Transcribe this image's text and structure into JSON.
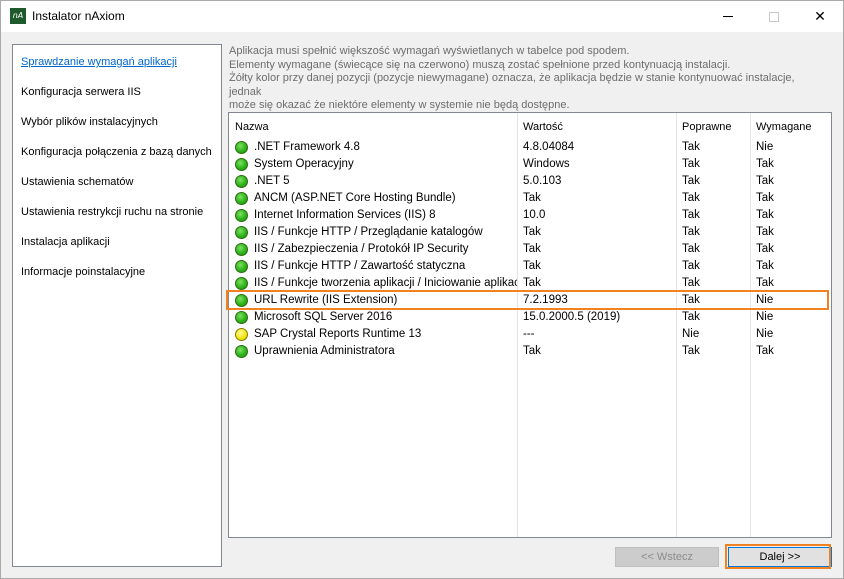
{
  "window": {
    "title": "Instalator nAxiom",
    "icon_label": "nA",
    "icon_color": "#1f5a2c"
  },
  "sidebar": {
    "items": [
      {
        "label": "Sprawdzanie wymagań aplikacji",
        "active": true
      },
      {
        "label": "Konfiguracja serwera IIS",
        "active": false
      },
      {
        "label": "Wybór plików instalacyjnych",
        "active": false
      },
      {
        "label": "Konfiguracja połączenia z bazą danych",
        "active": false
      },
      {
        "label": "Ustawienia schematów",
        "active": false
      },
      {
        "label": "Ustawienia restrykcji ruchu na stronie",
        "active": false
      },
      {
        "label": "Instalacja aplikacji",
        "active": false
      },
      {
        "label": "Informacje poinstalacyjne",
        "active": false
      }
    ]
  },
  "info": {
    "lines": [
      "Aplikacja musi spełnić większość wymagań wyświetlanych w tabelce pod spodem.",
      "Elementy wymagane (świecące się na czerwono) muszą zostać spełnione przed kontynuacją instalacji.",
      "Żółty kolor przy danej pozycji (pozycje niewymagane) oznacza, że aplikacja będzie w stanie kontynuować instalacje, jednak",
      "może się okazać że niektóre elementy w systemie nie będą dostępne."
    ]
  },
  "table": {
    "headers": [
      "Nazwa",
      "Wartość",
      "Poprawne",
      "Wymagane"
    ],
    "rows": [
      {
        "status": "green",
        "name": ".NET Framework 4.8",
        "value": "4.8.04084",
        "ok": "Tak",
        "required": "Nie"
      },
      {
        "status": "green",
        "name": "System Operacyjny",
        "value": "Windows",
        "ok": "Tak",
        "required": "Tak"
      },
      {
        "status": "green",
        "name": ".NET 5",
        "value": "5.0.103",
        "ok": "Tak",
        "required": "Tak"
      },
      {
        "status": "green",
        "name": "ANCM (ASP.NET Core Hosting Bundle)",
        "value": "Tak",
        "ok": "Tak",
        "required": "Tak"
      },
      {
        "status": "green",
        "name": "Internet Information Services (IIS) 8",
        "value": "10.0",
        "ok": "Tak",
        "required": "Tak"
      },
      {
        "status": "green",
        "name": "IIS / Funkcje HTTP / Przeglądanie katalogów",
        "value": "Tak",
        "ok": "Tak",
        "required": "Tak"
      },
      {
        "status": "green",
        "name": "IIS / Zabezpieczenia / Protokół IP Security",
        "value": "Tak",
        "ok": "Tak",
        "required": "Tak"
      },
      {
        "status": "green",
        "name": "IIS / Funkcje HTTP / Zawartość statyczna",
        "value": "Tak",
        "ok": "Tak",
        "required": "Tak"
      },
      {
        "status": "green",
        "name": "IIS / Funkcje tworzenia aplikacji / Iniciowanie aplikacji",
        "value": "Tak",
        "ok": "Tak",
        "required": "Tak"
      },
      {
        "status": "green",
        "name": "URL Rewrite (IIS Extension)",
        "value": "7.2.1993",
        "ok": "Tak",
        "required": "Nie"
      },
      {
        "status": "green",
        "name": "Microsoft SQL Server 2016",
        "value": "15.0.2000.5 (2019)",
        "ok": "Tak",
        "required": "Nie"
      },
      {
        "status": "yellow",
        "name": "SAP Crystal Reports Runtime 13",
        "value": "---",
        "ok": "Nie",
        "required": "Nie"
      },
      {
        "status": "green",
        "name": "Uprawnienia Administratora",
        "value": "Tak",
        "ok": "Tak",
        "required": "Tak"
      }
    ]
  },
  "buttons": {
    "back": "<< Wstecz",
    "next": "Dalej >>"
  },
  "colors": {
    "accent_link": "#0066cc",
    "highlight": "#f08222",
    "status_green": "#2fb31a",
    "status_yellow": "#f5e614"
  }
}
